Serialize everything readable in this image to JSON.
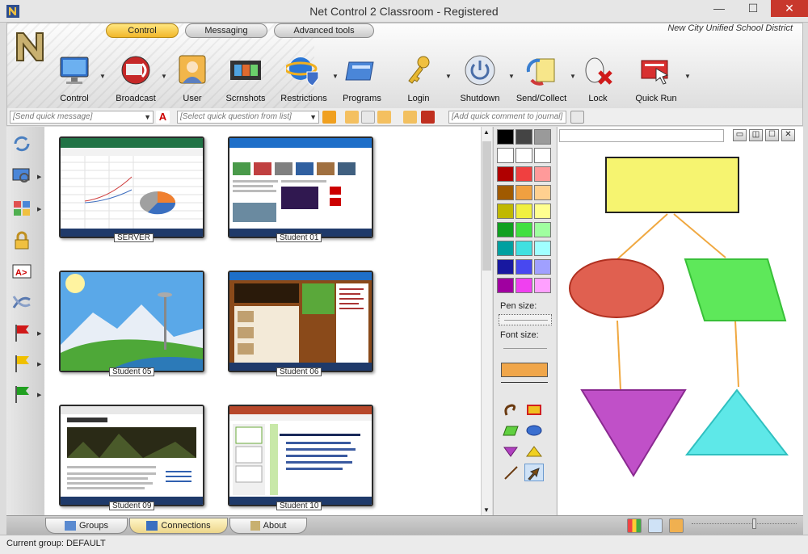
{
  "window": {
    "title": "Net Control 2 Classroom - Registered",
    "minimize": "—",
    "restore": "☐",
    "close": "✕"
  },
  "header": {
    "district": "New City Unified School District",
    "tabs": [
      {
        "label": "Control"
      },
      {
        "label": "Messaging"
      },
      {
        "label": "Advanced tools"
      }
    ],
    "tools": [
      {
        "label": "Control",
        "icon": "monitor-icon"
      },
      {
        "label": "Broadcast",
        "icon": "broadcast-icon"
      },
      {
        "label": "User",
        "icon": "user-icon"
      },
      {
        "label": "Scrnshots",
        "icon": "filmstrip-icon"
      },
      {
        "label": "Restrictions",
        "icon": "ie-shield-icon"
      },
      {
        "label": "Programs",
        "icon": "programs-window-icon"
      },
      {
        "label": "Login",
        "icon": "keys-icon"
      },
      {
        "label": "Shutdown",
        "icon": "power-icon"
      },
      {
        "label": "Send/Collect",
        "icon": "send-collect-icon"
      },
      {
        "label": "Lock",
        "icon": "mouse-lock-icon"
      },
      {
        "label": "Quick Run",
        "icon": "quick-run-icon"
      }
    ]
  },
  "quickbar": {
    "message_placeholder": "[Send quick message]",
    "question_placeholder": "[Select quick question from list]",
    "journal_placeholder": "[Add quick comment to journal]"
  },
  "students": [
    {
      "name": "SERVER"
    },
    {
      "name": "Student 01"
    },
    {
      "name": "Student 05"
    },
    {
      "name": "Student 06"
    },
    {
      "name": "Student 09"
    },
    {
      "name": "Student 10"
    }
  ],
  "palette": {
    "colors": [
      "#000000",
      "#444444",
      "#9a9a9a",
      "#ffffff",
      "#ffffff",
      "#ffffff",
      "#b00000",
      "#f04040",
      "#ff9a9a",
      "#a05a00",
      "#f0a040",
      "#ffd090",
      "#c0b800",
      "#f0f040",
      "#ffff90",
      "#10a020",
      "#40e040",
      "#a0ffa0",
      "#00a0a0",
      "#40e0e0",
      "#a0ffff",
      "#1818a0",
      "#4848f0",
      "#a0a0ff",
      "#a000a0",
      "#f040f0",
      "#ffa0ff"
    ],
    "pen_size_label": "Pen size:",
    "font_size_label": "Font size:",
    "current_color": "#f0a64a"
  },
  "bottom": {
    "tabs": [
      {
        "label": "Groups"
      },
      {
        "label": "Connections"
      },
      {
        "label": "About"
      }
    ]
  },
  "status": {
    "text": "Current group: DEFAULT"
  },
  "colors": {
    "accent_tab": "#f4c430",
    "close_red": "#c8382c"
  }
}
